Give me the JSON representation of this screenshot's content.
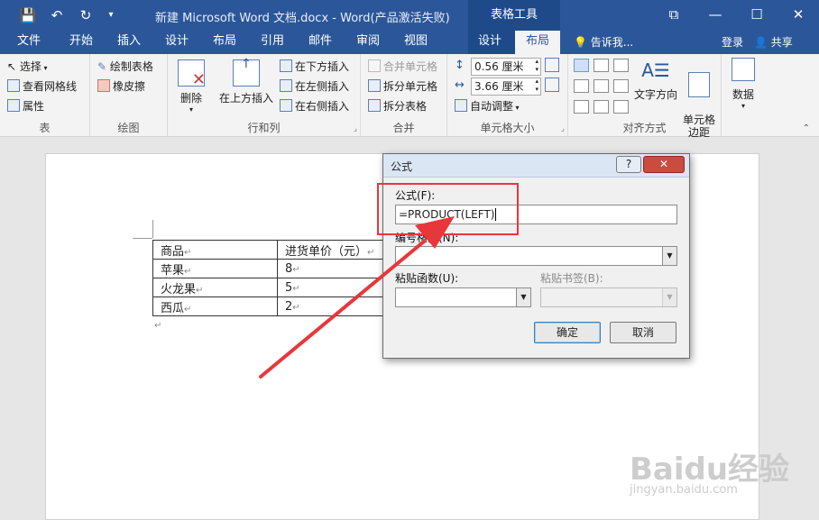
{
  "titlebar": {
    "doc_title": "新建 Microsoft Word 文档.docx - Word(产品激活失败)",
    "context_tab": "表格工具",
    "qa_save": "💾",
    "qa_undo": "↶",
    "qa_redo": "↻",
    "qa_more": "▾",
    "win_restore": "⧉",
    "win_min": "—",
    "win_max": "☐",
    "win_close": "✕"
  },
  "tabs": [
    "文件",
    "开始",
    "插入",
    "设计",
    "布局",
    "引用",
    "邮件",
    "审阅",
    "视图",
    "设计",
    "布局"
  ],
  "active_tab_index": 10,
  "tell_me": "告诉我...",
  "sign_in": "登录",
  "share": "共享",
  "ribbon": {
    "table": {
      "label": "表",
      "select": "选择",
      "gridlines": "查看网格线",
      "properties": "属性"
    },
    "draw": {
      "label": "绘图",
      "draw_table": "绘制表格",
      "eraser": "橡皮擦"
    },
    "rowscols": {
      "label": "行和列",
      "delete": "删除",
      "insert_above": "在上方插入",
      "insert_below": "在下方插入",
      "insert_left": "在左侧插入",
      "insert_right": "在右侧插入"
    },
    "merge": {
      "label": "合并",
      "merge_cells": "合并单元格",
      "split_cells": "拆分单元格",
      "split_table": "拆分表格"
    },
    "cellsize": {
      "label": "单元格大小",
      "height": "0.56 厘米",
      "width": "3.66 厘米",
      "autofit": "自动调整"
    },
    "alignment": {
      "label": "对齐方式",
      "text_direction": "文字方向",
      "cell_margins": "单元格\n边距"
    },
    "data": {
      "label": "数据"
    }
  },
  "table": {
    "rows": [
      [
        "商品",
        "进货单价（元）"
      ],
      [
        "苹果",
        "8"
      ],
      [
        "火龙果",
        "5"
      ],
      [
        "西瓜",
        "2"
      ]
    ],
    "cell_mark": "↵",
    "para_mark": "↵"
  },
  "dialog": {
    "title": "公式",
    "help": "?",
    "close": "✕",
    "formula_label": "公式(F):",
    "formula_value": "=PRODUCT(LEFT)",
    "number_format_label": "编号格式(N):",
    "paste_function_label": "粘贴函数(U):",
    "paste_bookmark_label": "粘贴书签(B):",
    "ok": "确定",
    "cancel": "取消"
  },
  "watermark": {
    "logo": "Baidu经验",
    "url": "jingyan.baidu.com"
  },
  "colors": {
    "word_blue": "#2b579a",
    "context_blue": "#1e4a8a",
    "annotation_red": "#e8373a"
  }
}
